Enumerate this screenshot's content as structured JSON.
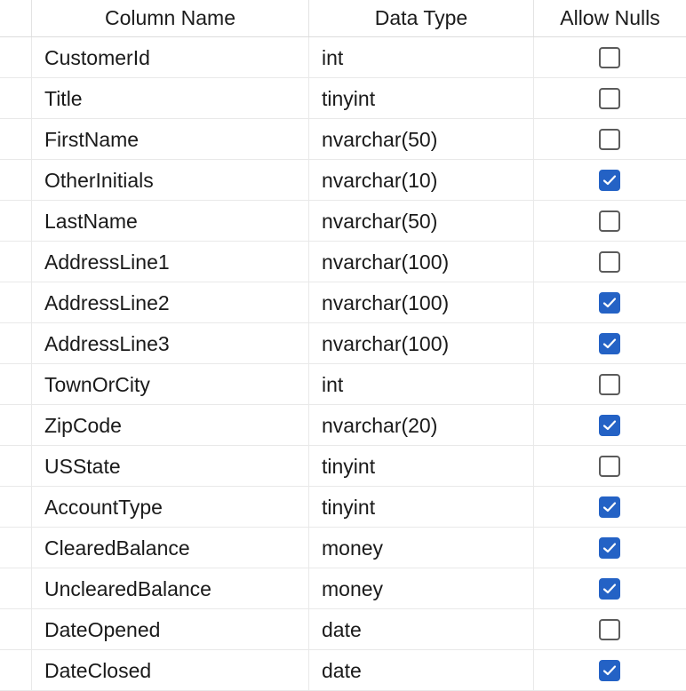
{
  "headers": {
    "column_name": "Column Name",
    "data_type": "Data Type",
    "allow_nulls": "Allow Nulls"
  },
  "rows": [
    {
      "name": "CustomerId",
      "type": "int",
      "allow_nulls": false
    },
    {
      "name": "Title",
      "type": "tinyint",
      "allow_nulls": false
    },
    {
      "name": "FirstName",
      "type": "nvarchar(50)",
      "allow_nulls": false
    },
    {
      "name": "OtherInitials",
      "type": "nvarchar(10)",
      "allow_nulls": true
    },
    {
      "name": "LastName",
      "type": "nvarchar(50)",
      "allow_nulls": false
    },
    {
      "name": "AddressLine1",
      "type": "nvarchar(100)",
      "allow_nulls": false
    },
    {
      "name": "AddressLine2",
      "type": "nvarchar(100)",
      "allow_nulls": true
    },
    {
      "name": "AddressLine3",
      "type": "nvarchar(100)",
      "allow_nulls": true
    },
    {
      "name": "TownOrCity",
      "type": "int",
      "allow_nulls": false
    },
    {
      "name": "ZipCode",
      "type": "nvarchar(20)",
      "allow_nulls": true
    },
    {
      "name": "USState",
      "type": "tinyint",
      "allow_nulls": false
    },
    {
      "name": "AccountType",
      "type": "tinyint",
      "allow_nulls": true
    },
    {
      "name": "ClearedBalance",
      "type": "money",
      "allow_nulls": true
    },
    {
      "name": "UnclearedBalance",
      "type": "money",
      "allow_nulls": true
    },
    {
      "name": "DateOpened",
      "type": "date",
      "allow_nulls": false
    },
    {
      "name": "DateClosed",
      "type": "date",
      "allow_nulls": true
    }
  ],
  "colors": {
    "checkbox_checked": "#2462c5",
    "checkbox_border": "#5b5b5b"
  },
  "icons": {
    "checked": "checkmark-icon"
  }
}
